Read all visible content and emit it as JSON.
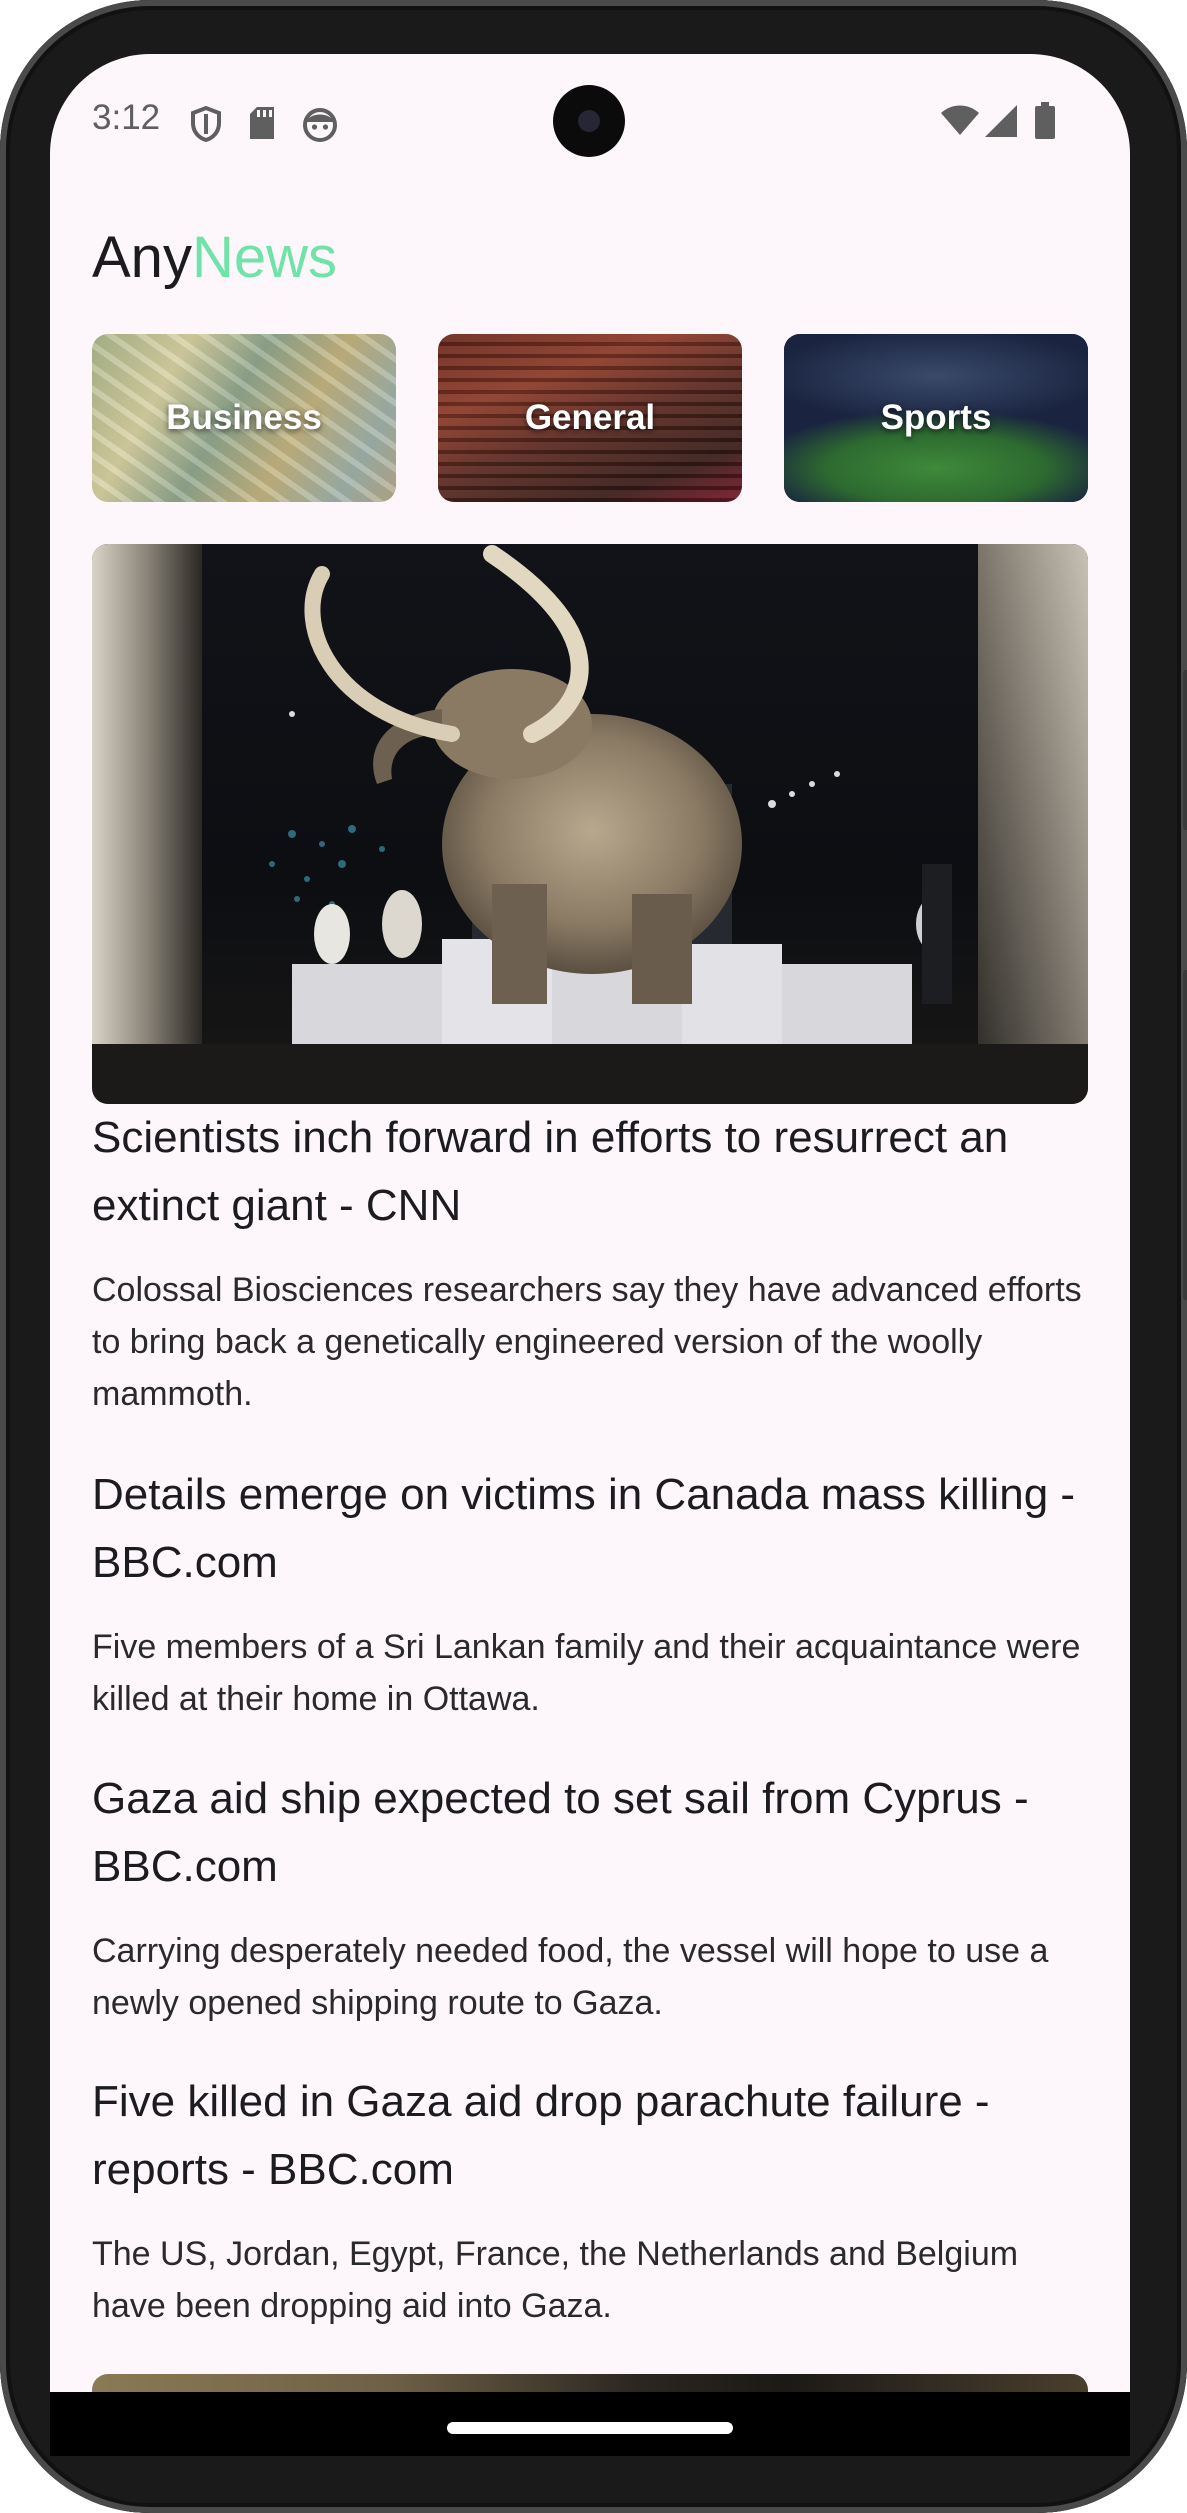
{
  "status_bar": {
    "time": "3:12",
    "left_icons": [
      "shield-icon",
      "sd-card-icon",
      "android-face-icon"
    ],
    "right_icons": [
      "wifi-icon",
      "signal-icon",
      "battery-icon"
    ]
  },
  "app": {
    "title_part1": "Any",
    "title_part2": "News",
    "accent_color": "#6fe3a8"
  },
  "categories": [
    {
      "label": "Business"
    },
    {
      "label": "General"
    },
    {
      "label": "Sports"
    }
  ],
  "articles": [
    {
      "title": "Scientists inch forward in efforts to resurrect an extinct giant - CNN",
      "description": "Colossal Biosciences researchers say they have advanced efforts to bring back a genetically engineered version of the woolly mammoth."
    },
    {
      "title": "Details emerge on victims in Canada mass killing - BBC.com",
      "description": "Five members of a Sri Lankan family and their acquaintance were killed at their home in Ottawa."
    },
    {
      "title": "Gaza aid ship expected to set sail from Cyprus - BBC.com",
      "description": "Carrying desperately needed food, the vessel will hope to use a newly opened shipping route to Gaza."
    },
    {
      "title": "Five killed in Gaza aid drop parachute failure - reports - BBC.com",
      "description": "The US, Jordan, Egypt, France, the Netherlands and Belgium have been dropping aid into Gaza."
    }
  ]
}
